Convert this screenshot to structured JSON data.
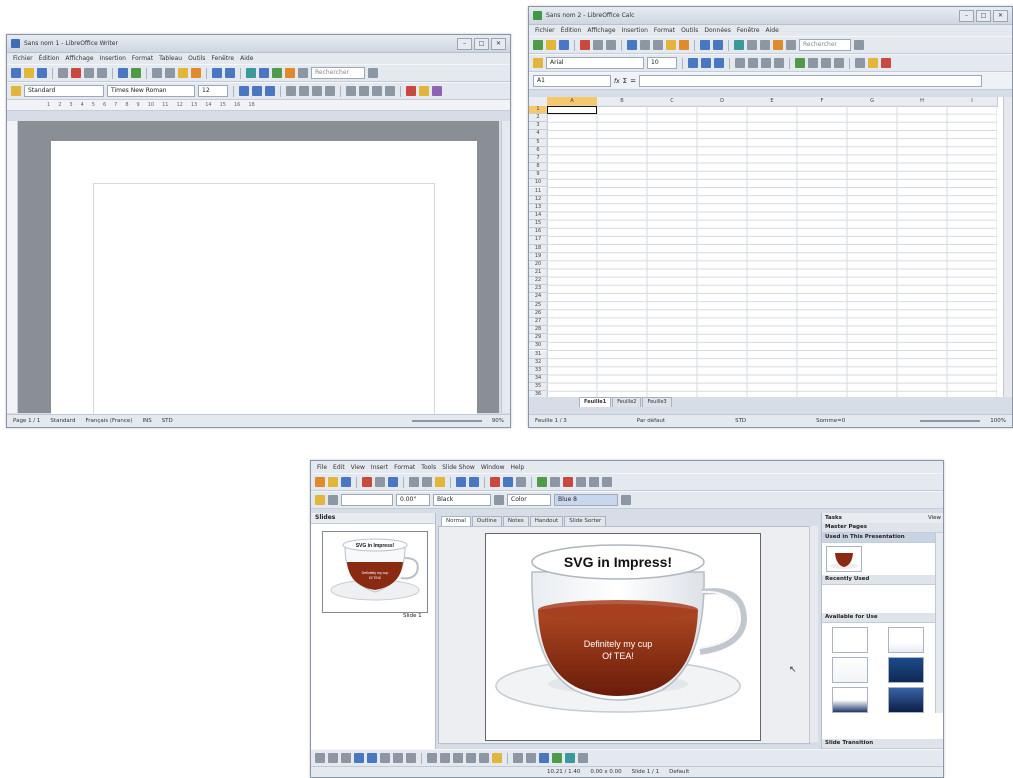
{
  "writer": {
    "title": "Sans nom 1 - LibreOffice Writer",
    "menu": [
      "Fichier",
      "Édition",
      "Affichage",
      "Insertion",
      "Format",
      "Tableau",
      "Outils",
      "Fenêtre",
      "Aide"
    ],
    "search_placeholder": "Rechercher",
    "style_value": "Standard",
    "font_value": "Times New Roman",
    "size_value": "12",
    "ruler_marks": [
      "1",
      "2",
      "3",
      "4",
      "5",
      "6",
      "7",
      "8",
      "9",
      "10",
      "11",
      "12",
      "13",
      "14",
      "15",
      "16",
      "18"
    ],
    "status": {
      "page": "Page 1 / 1",
      "style": "Standard",
      "language": "Français (France)",
      "ins": "INS",
      "std": "STD",
      "zoom": "90%"
    },
    "window_buttons": [
      "–",
      "□",
      "✕"
    ]
  },
  "calc": {
    "title": "Sans nom 2 - LibreOffice Calc",
    "menu": [
      "Fichier",
      "Édition",
      "Affichage",
      "Insertion",
      "Format",
      "Outils",
      "Données",
      "Fenêtre",
      "Aide"
    ],
    "search_placeholder": "Rechercher",
    "font_value": "Arial",
    "size_value": "10",
    "name_box": "A1",
    "formula_icons": [
      "fx",
      "Σ",
      "="
    ],
    "columns": [
      "A",
      "B",
      "C",
      "D",
      "E",
      "F",
      "G",
      "H",
      "I"
    ],
    "rows": [
      "1",
      "2",
      "3",
      "4",
      "5",
      "6",
      "7",
      "8",
      "9",
      "10",
      "11",
      "12",
      "13",
      "14",
      "15",
      "16",
      "17",
      "18",
      "19",
      "20",
      "21",
      "22",
      "23",
      "24",
      "25",
      "26",
      "27",
      "28",
      "29",
      "30",
      "31",
      "32",
      "33",
      "34",
      "35",
      "36"
    ],
    "sheets": [
      "Feuille1",
      "Feuille2",
      "Feuille3"
    ],
    "status": {
      "sheet": "Feuille 1 / 3",
      "style": "Par défaut",
      "std": "STD",
      "sum": "Somme=0",
      "zoom": "100%"
    },
    "window_buttons": [
      "–",
      "□",
      "✕"
    ]
  },
  "impress": {
    "menu": [
      "File",
      "Edit",
      "View",
      "Insert",
      "Format",
      "Tools",
      "Slide Show",
      "Window",
      "Help"
    ],
    "line_width": "0.00\"",
    "line_color": "Black",
    "area_style": "Color",
    "area_color": "Blue 8",
    "slides_title": "Slides",
    "slide_label": "Slide 1",
    "view_tabs": [
      "Normal",
      "Outline",
      "Notes",
      "Handout",
      "Slide Sorter"
    ],
    "slide_title": "SVG in Impress!",
    "slide_caption_1": "Definitely my cup",
    "slide_caption_2": "Of TEA!",
    "tasks": {
      "title": "Tasks",
      "view": "View",
      "master_pages": "Master Pages",
      "used": "Used in This Presentation",
      "recent": "Recently Used",
      "available": "Available for Use",
      "slide_transition": "Slide Transition"
    },
    "status": {
      "position": "10.21 / 1.40",
      "size": "0.00 x 0.00",
      "slide": "Slide 1 / 1",
      "layout": "Default"
    }
  },
  "colors": {
    "chrome": "#d7dde7",
    "tea": "#8a2a12",
    "selection": "#1f5fb8"
  }
}
